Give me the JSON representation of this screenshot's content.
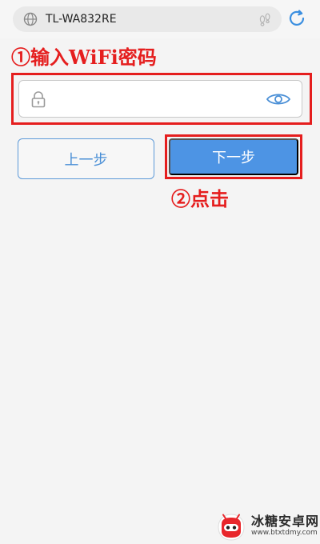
{
  "browser": {
    "url": "TL-WA832RE",
    "icons": {
      "globe": "globe-icon",
      "footprint": "footprint-icon",
      "refresh": "refresh-icon"
    }
  },
  "annotations": {
    "step1": "①输入WiFi密码",
    "step2": "②点击"
  },
  "password": {
    "value": "",
    "icons": {
      "lock": "lock-icon",
      "show": "eye-icon"
    }
  },
  "buttons": {
    "prev": "上一步",
    "next": "下一步"
  },
  "watermark": {
    "title": "冰糖安卓网",
    "url": "www.btxtdmy.com"
  },
  "colors": {
    "accent": "#4d94e4",
    "annotation": "#e51e1e",
    "background": "#f4f4f4"
  }
}
